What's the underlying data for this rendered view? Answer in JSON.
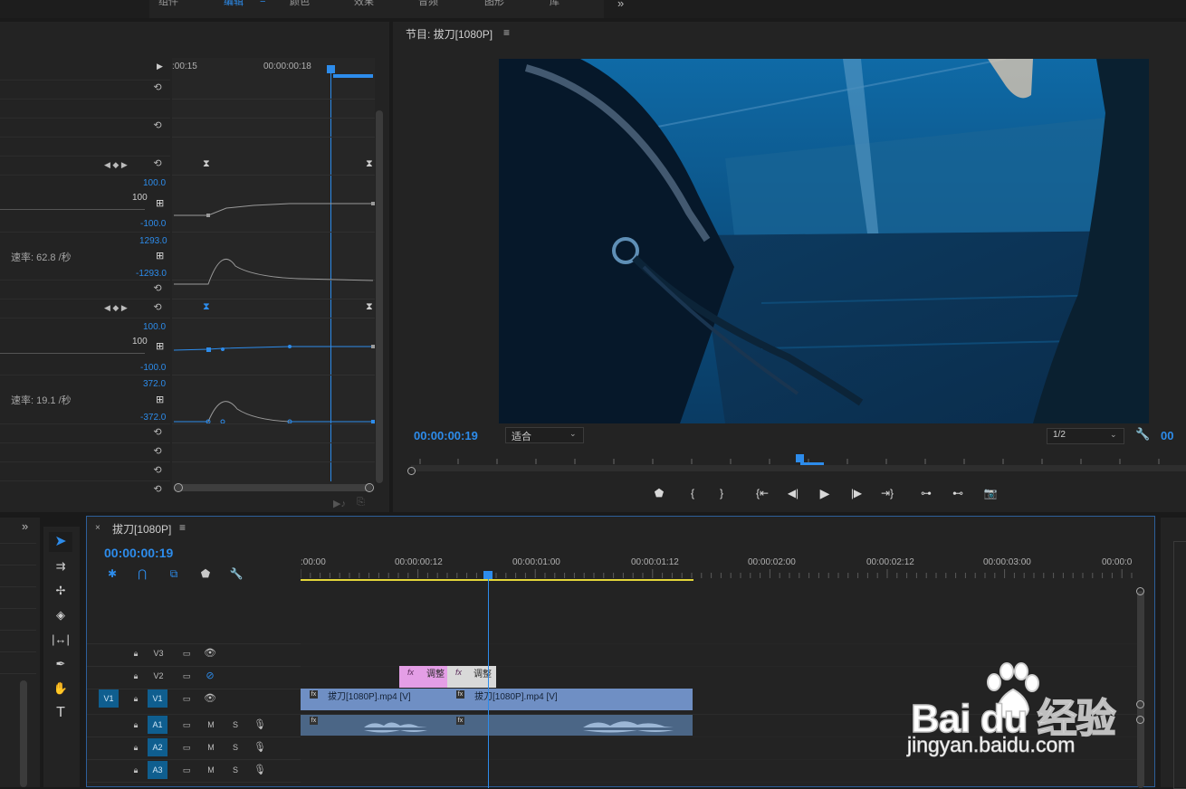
{
  "workspace_tabs": [
    "组件",
    "编辑",
    "颜色",
    "效果",
    "音频",
    "图形",
    "库"
  ],
  "workspace_more": "»",
  "effect_controls": {
    "ruler_labels": [
      ":00:15",
      "00:00:00:18"
    ],
    "curve1": {
      "max": "100.0",
      "mid": "100",
      "min": "-100.0"
    },
    "velocity1": {
      "max": "1293.0",
      "label": "速率: 62.8 /秒",
      "min": "-1293.0"
    },
    "curve2": {
      "max": "100.0",
      "mid": "100",
      "min": "-100.0"
    },
    "velocity2": {
      "max": "372.0",
      "label": "速率: 19.1 /秒",
      "min": "-372.0"
    },
    "reset_icon": "⟲",
    "keyframe_nav": "◀ ◆ ▶"
  },
  "program_monitor": {
    "title": "节目: 拔刀[1080P]",
    "menu_icon": "≡",
    "timecode": "00:00:00:19",
    "fit_label": "适合",
    "resolution": "1/2",
    "controls": [
      "marker-icon",
      "mark-in-icon",
      "mark-out-icon",
      "go-to-in-icon",
      "step-back-icon",
      "play-icon",
      "step-forward-icon",
      "go-to-out-icon",
      "insert-icon",
      "overwrite-icon",
      "export-frame-icon"
    ]
  },
  "timeline": {
    "sequence_name": "拔刀[1080P]",
    "close": "×",
    "menu_icon": "≡",
    "timecode": "00:00:00:19",
    "ruler_labels": [
      ":00:00",
      "00:00:00:12",
      "00:00:01:00",
      "00:00:01:12",
      "00:00:02:00",
      "00:00:02:12",
      "00:00:03:00",
      "00:00:0"
    ],
    "tracks": {
      "v3": "V3",
      "v2": "V2",
      "v1": "V1",
      "v1_src": "V1",
      "a1": "A1",
      "a2": "A2",
      "a3": "A3",
      "mute": "M",
      "solo": "S"
    },
    "clips": {
      "adj1": "调整",
      "adj2": "调整",
      "video1": "拔刀[1080P].mp4 [V]",
      "video2": "拔刀[1080P].mp4 [V]",
      "fx": "fx"
    }
  },
  "watermark": {
    "brand": "Bai du 经验",
    "url": "jingyan.baidu.com"
  },
  "colors": {
    "accent": "#2d8ceb",
    "video_clip": "#6f8fc4",
    "audio_clip": "#4b6686",
    "adjustment_clip_pink": "#e49ee6",
    "adjustment_clip_gray": "#d9d9d9",
    "work_area": "#e3d63a"
  }
}
